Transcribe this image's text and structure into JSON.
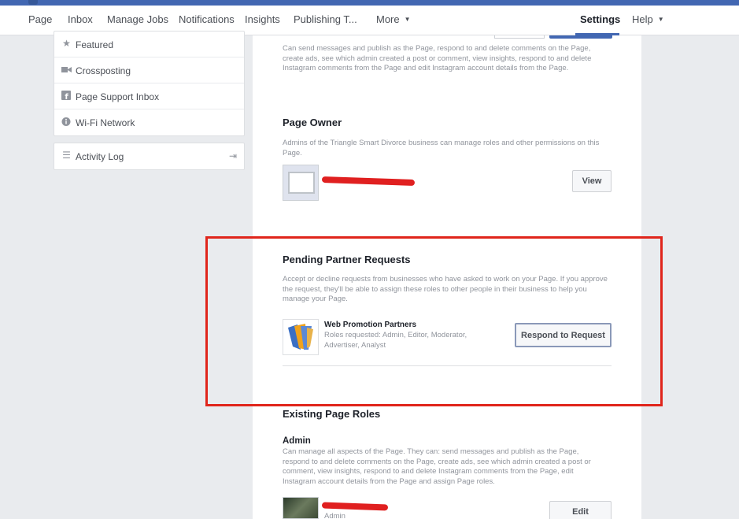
{
  "nav": {
    "items": [
      "Page",
      "Inbox",
      "Manage Jobs",
      "Notifications",
      "Insights",
      "Publishing T..."
    ],
    "more": "More",
    "settings": "Settings",
    "help": "Help"
  },
  "sidebar": {
    "items": [
      {
        "label": "Featured",
        "icon": "star-icon"
      },
      {
        "label": "Crossposting",
        "icon": "video-camera-icon"
      },
      {
        "label": "Page Support Inbox",
        "icon": "facebook-icon"
      },
      {
        "label": "Wi-Fi Network",
        "icon": "info-icon"
      }
    ],
    "activity_log": "Activity Log"
  },
  "editor_section": {
    "desc": "Can send messages and publish as the Page, respond to and delete comments on the Page, create ads, see which admin created a post or comment, view insights, respond to and delete Instagram comments from the Page and edit Instagram account details from the Page."
  },
  "page_owner": {
    "title": "Page Owner",
    "desc": "Admins of the Triangle Smart Divorce business can manage roles and other permissions on this Page.",
    "view_button": "View"
  },
  "pending": {
    "title": "Pending Partner Requests",
    "desc": "Accept or decline requests from businesses who have asked to work on your Page. If you approve the request, they'll be able to assign these roles to other people in their business to help you manage your Page.",
    "partner_name": "Web Promotion Partners",
    "roles": "Roles requested: Admin, Editor, Moderator, Advertiser, Analyst",
    "respond_button": "Respond to Request"
  },
  "existing": {
    "title": "Existing Page Roles",
    "admin_title": "Admin",
    "admin_desc": "Can manage all aspects of the Page. They can: send messages and publish as the Page, respond to and delete comments on the Page, create ads, see which admin created a post or comment, view insights, respond to and delete Instagram comments from the Page, edit Instagram account details from the Page and assign Page roles.",
    "edit_button": "Edit",
    "person_role": "Admin"
  },
  "colors": {
    "facebook_blue": "#4267b2",
    "highlight_red": "#e0251b",
    "redaction_red": "#e02020"
  }
}
